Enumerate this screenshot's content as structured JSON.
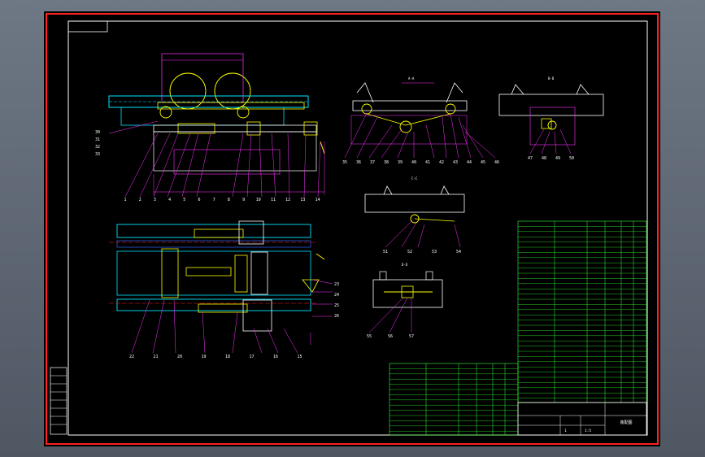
{
  "drawing": {
    "background": "#000000",
    "frame_color": "#ff0000",
    "border_color": "#ffffff",
    "colors": {
      "cyan": "#00e5ff",
      "magenta": "#ff33ff",
      "yellow": "#ffff00",
      "green": "#33ff33",
      "white": "#ffffff",
      "red": "#ff2020",
      "blue": "#3366ff"
    },
    "view_labels": {
      "front_view": "",
      "section_a": "A-A",
      "section_b": "B-B",
      "section_c": "C-C",
      "section_d": "D-D"
    },
    "top_balloons": [
      "1",
      "2",
      "3",
      "4",
      "5",
      "6",
      "7",
      "8",
      "9",
      "10",
      "11",
      "12",
      "13",
      "14"
    ],
    "bottom_balloons": [
      "22",
      "21",
      "20",
      "19",
      "18",
      "17",
      "16",
      "15"
    ],
    "left_balloons": [
      "30",
      "31",
      "32",
      "33"
    ],
    "right_balloons": [
      "23",
      "24",
      "25",
      "26"
    ],
    "section_a_balloons": [
      "35",
      "36",
      "37",
      "38",
      "39",
      "40",
      "41",
      "42",
      "43",
      "44",
      "45",
      "46"
    ],
    "section_b_balloons": [
      "47",
      "48",
      "49",
      "50"
    ],
    "section_c_balloons": [
      "51",
      "52",
      "53",
      "54"
    ],
    "section_d_balloons": [
      "55",
      "56",
      "57"
    ]
  },
  "title_block": {
    "drawing_name": "装配图",
    "scale": "1:5",
    "sheet": "1"
  }
}
